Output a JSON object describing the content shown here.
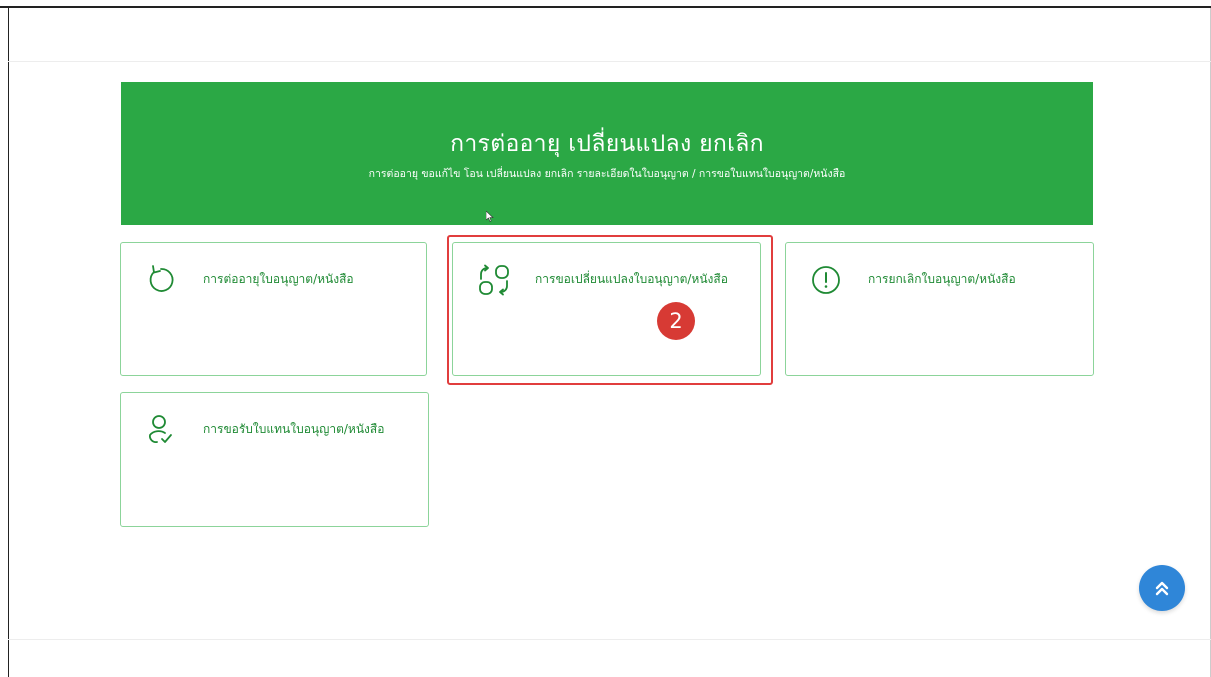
{
  "hero": {
    "title": "การต่ออายุ เปลี่ยนแปลง ยกเลิก",
    "subtitle": "การต่ออายุ ขอแก้ไข โอน เปลี่ยนแปลง ยกเลิก รายละเอียดในใบอนุญาต / การขอใบแทนใบอนุญาต/หนังสือ"
  },
  "cards": [
    {
      "label": "การต่ออายุใบอนุญาต/หนังสือ",
      "icon": "renew-icon"
    },
    {
      "label": "การขอเปลี่ยนแปลงใบอนุญาต/หนังสือ",
      "icon": "change-icon"
    },
    {
      "label": "การยกเลิกใบอนุญาต/หนังสือ",
      "icon": "cancel-icon"
    },
    {
      "label": "การขอรับใบแทนใบอนุญาต/หนังสือ",
      "icon": "replacement-icon"
    }
  ],
  "annotation": {
    "step_number": "2",
    "highlight_color": "#e13d3d"
  },
  "colors": {
    "brand_green": "#2ba845",
    "card_border": "#8cd49a",
    "text_green": "#1f8a34",
    "scroll_button": "#2f86d8",
    "badge_red": "#d73a34"
  },
  "scroll_top_button": {
    "icon": "double-chevron-up-icon"
  }
}
